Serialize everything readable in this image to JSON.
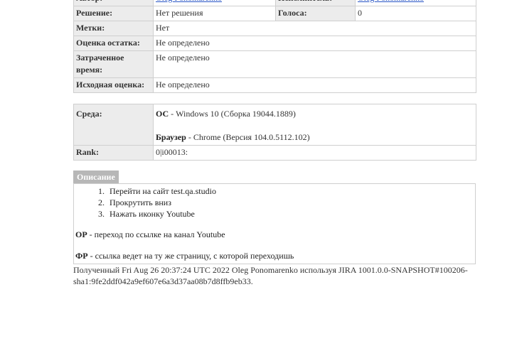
{
  "fields_top": {
    "author_label": "Автор:",
    "author_value": "Oleg Ponomarenko",
    "assignee_label": "Исполнитель:",
    "assignee_value": "Oleg Ponomarenko",
    "resolution_label": "Решение:",
    "resolution_value": "Нет решения",
    "votes_label": "Голоса:",
    "votes_value": "0",
    "labels_label": "Метки:",
    "labels_value": "Нет",
    "remaining_label": "Оценка остатка:",
    "remaining_value": "Не определено",
    "spent_label": "Затраченное время:",
    "spent_value": "Не определено",
    "original_label": "Исходная оценка:",
    "original_value": "Не определено"
  },
  "env": {
    "env_label": "Среда:",
    "os_label": "ОС",
    "os_value": " - Windows 10 (Сборка 19044.1889)",
    "browser_label": "Браузер",
    "browser_value": " - Chrome (Версия 104.0.5112.102)",
    "rank_label": "Rank:",
    "rank_value": "0|i00013:"
  },
  "description": {
    "tab_label": "Описание",
    "steps": [
      "Перейти на сайт test.qa.studio",
      "Прокрутить вниз",
      "Нажать иконку Youtube"
    ],
    "or_label": "ОР",
    "or_text": " - переход по ссылке на канал Youtube",
    "fr_label": "ФР",
    "fr_text": " - ссылка ведет на ту же страницу, с которой переходишь"
  },
  "footer": {
    "text": "Полученный Fri Aug 26 20:37:24 UTC 2022 Oleg Ponomarenko используя JIRA 1001.0.0-SNAPSHOT#100206-sha1:9fe2ddf042a9ef607e6a3d37aa08b7d8ffb9eb33."
  }
}
